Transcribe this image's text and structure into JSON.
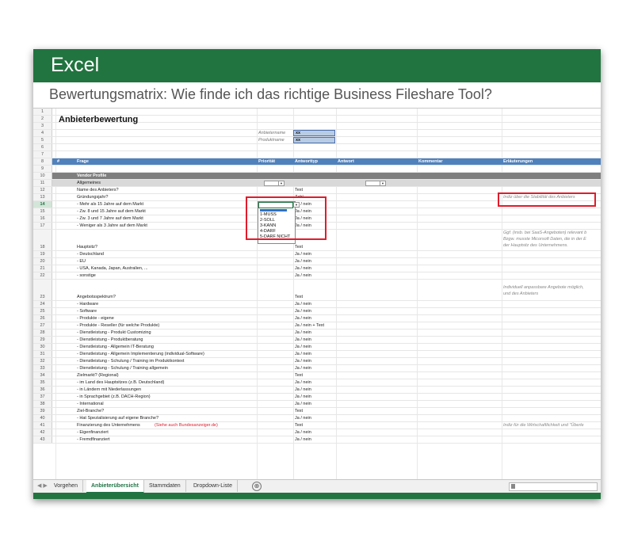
{
  "app": {
    "name": "Excel",
    "subtitle": "Bewertungsmatrix: Wie finde ich das richtige Business Fileshare Tool?"
  },
  "sheet": {
    "title": "Anbieterbewertung",
    "labels": {
      "anbietername": "Anbietername",
      "produktname": "Produktname",
      "xx1": "xx",
      "xx2": "xx"
    },
    "headers": {
      "num": "#",
      "frage": "Frage",
      "prio": "Priorität",
      "typ": "Antworttyp",
      "antwort": "Antwort",
      "kommentar": "Kommentar",
      "erl": "Erläuterungen"
    },
    "section": "Vendor Profile",
    "group": "Allgemeines",
    "r12": {
      "f": "Name des Anbieters?",
      "t": "Text"
    },
    "r13": {
      "f": "Gründungsjahr?",
      "t": "Zahl",
      "e": "Indiz über die Stabilität des Anbieters"
    },
    "r14": {
      "f": "- Mehr als 15 Jahre auf dem Markt",
      "t": "Ja / nein"
    },
    "r15": {
      "f": "- Zw. 8 und 15 Jahre auf dem Markt",
      "t": "Ja / nein"
    },
    "r16": {
      "f": "- Zw. 3 und 7 Jahre auf dem Markt",
      "t": "Ja / nein"
    },
    "r17": {
      "f": "- Weniger als 3 Jahre auf dem Markt",
      "t": "Ja / nein"
    },
    "r18": {
      "f": "Hauptsitz?",
      "t": "Text",
      "e1": "Ggf. (insb. bei SaaS-Angeboten) relevant b",
      "e2": "Bzgw. musste Micorsoft Daten, die in der E",
      "e3": "der Hauptsitz des Unternehmens."
    },
    "r19": {
      "f": "- Deutschland",
      "t": "Ja / nein"
    },
    "r20": {
      "f": "- EU",
      "t": "Ja / nein"
    },
    "r21": {
      "f": "- USA, Kanada, Japan, Australien, ...",
      "t": "Ja / nein"
    },
    "r22": {
      "f": "- sonstige",
      "t": "Ja / nein"
    },
    "r23": {
      "f": "Angebotsspektrum?",
      "t": "Text",
      "e1": "Individuell anpassbare Angebote möglich,",
      "e2": "und des Anbieters"
    },
    "r24": {
      "f": "- Hardware",
      "t": "Ja / nein"
    },
    "r25": {
      "f": "- Software",
      "t": "Ja / nein"
    },
    "r26": {
      "f": "- Produkte - eigene",
      "t": "Ja / nein"
    },
    "r27": {
      "f": "- Produkte - Reseller (für welche Produkte)",
      "t": "Ja / nein + Text"
    },
    "r28": {
      "f": "- Dienstleistung - Produkt Customizing",
      "t": "Ja / nein"
    },
    "r29": {
      "f": "- Dienstleistung - Produktberatung",
      "t": "Ja / nein"
    },
    "r30": {
      "f": "- Dienstleistung - Allgemein IT-Beratung",
      "t": "Ja / nein"
    },
    "r31": {
      "f": "- Dienstleistung - Allgemein Implementierung (individual-Software)",
      "t": "Ja / nein"
    },
    "r32": {
      "f": "- Dienstleistung - Schulung / Training im Produktkontext",
      "t": "Ja / nein"
    },
    "r33": {
      "f": "- Dienstleistung - Schulung / Training allgemein",
      "t": "Ja / nein"
    },
    "r34": {
      "f": "Zielmarkt? (Regional)",
      "t": "Text"
    },
    "r35": {
      "f": "- im Land des Hauptsitzes (z.B. Deutschland)",
      "t": "Ja / nein"
    },
    "r36": {
      "f": "- in Ländern mit Niederlassungen",
      "t": "Ja / nein"
    },
    "r37": {
      "f": "- in Sprachgebiet (z.B. DACH-Region)",
      "t": "Ja / nein"
    },
    "r38": {
      "f": "- International",
      "t": "Ja / nein"
    },
    "r39": {
      "f": "Ziel-Branche?",
      "t": "Text"
    },
    "r40": {
      "f": "- Hat Spezialisierung auf eigene Branche?",
      "t": "Ja / nein"
    },
    "r41": {
      "f": "Finanzierung des Unternehmens",
      "link": "(Siehe auch Bundesanzeiger.de)",
      "t": "Text",
      "e": "Indiz für die Wirtschaftlichkeit und \"Überle"
    },
    "r42": {
      "f": "- Eigenfinanziert",
      "t": "Ja / nein"
    },
    "r43": {
      "f": "- Fremdfinanziert",
      "t": "Ja / nein"
    },
    "dropdown": [
      "1-MUSS",
      "2-SOLL",
      "3-KANN",
      "4-DARF",
      "5-DARF NICHT"
    ]
  },
  "tabs": [
    "Vorgehen",
    "Anbieterübersicht",
    "Stammdaten",
    "Dropdown-Liste"
  ],
  "add_tab": "⊕",
  "colors": {
    "excel_green": "#21743f",
    "header_blue": "#4f81bd",
    "highlight_red": "#e21b2b"
  }
}
